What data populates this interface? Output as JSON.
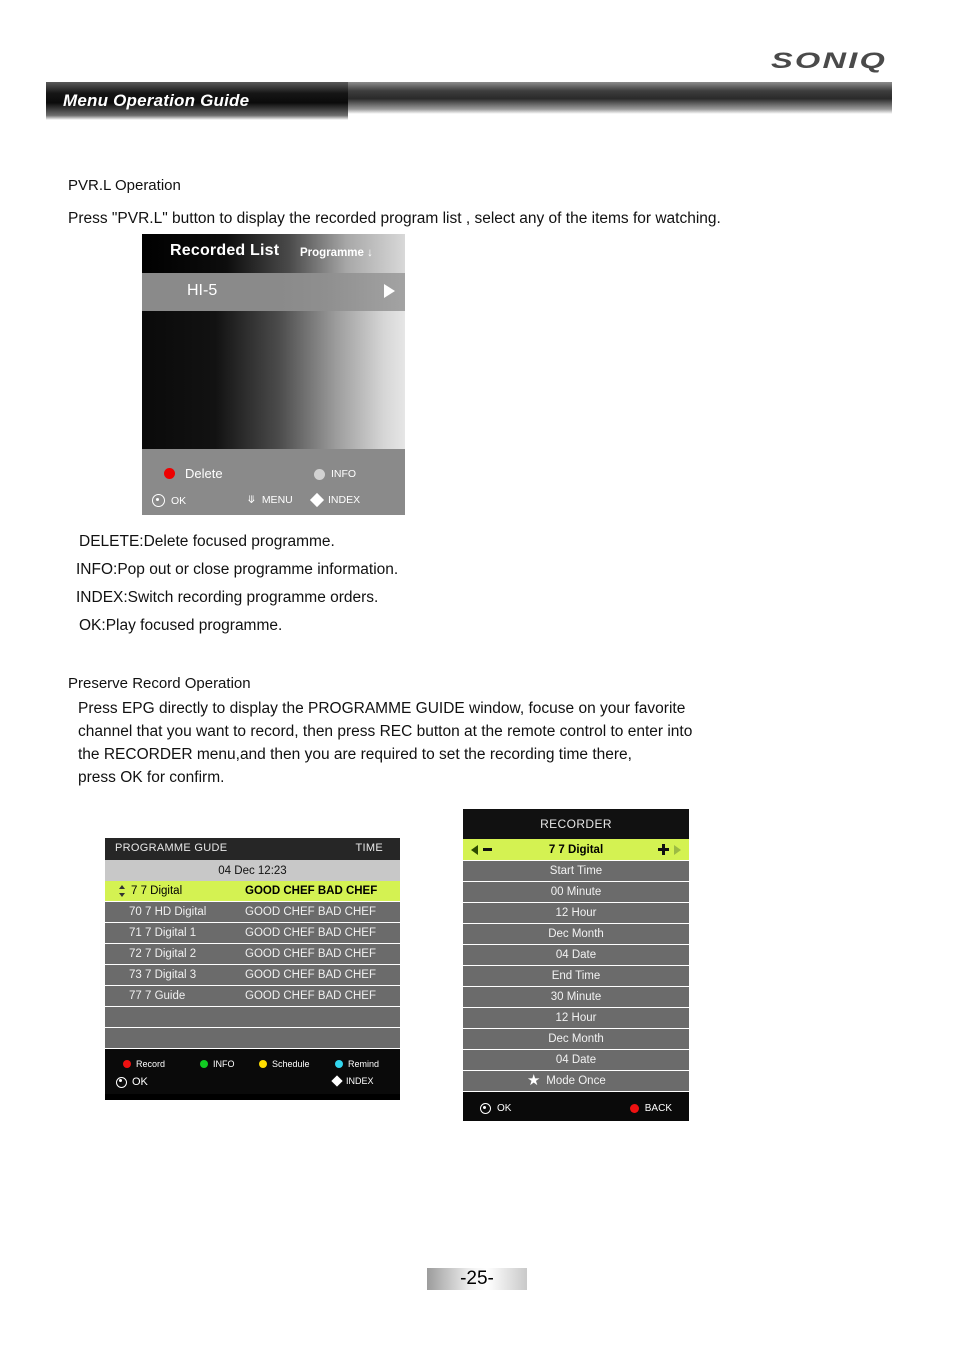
{
  "header": {
    "brand": "SONIQ",
    "tab_title": "Menu Operation Guide"
  },
  "sections": {
    "pvr": {
      "title": "PVR.L Operation",
      "intro": "Press \"PVR.L\" button to display the recorded program list , select any of the items for watching.",
      "notes": [
        "DELETE:Delete focused programme.",
        "INFO:Pop out or close programme information.",
        "INDEX:Switch recording programme orders.",
        "OK:Play focused programme."
      ]
    },
    "preserve": {
      "title": "Preserve Record Operation",
      "lines": [
        "Press EPG directly to display the PROGRAMME GUIDE window, focuse on your favorite",
        "channel that you want to record, then press REC button at the remote control to enter into",
        "the RECORDER menu,and then you are required to set the recording time there,",
        "press OK for confirm."
      ]
    }
  },
  "recorded_list": {
    "title": "Recorded List",
    "sort_label": "Programme ↓",
    "items": [
      {
        "label": "HI-5"
      }
    ],
    "footer": {
      "delete": "Delete",
      "info": "INFO",
      "ok": "OK",
      "menu": "MENU",
      "index": "INDEX"
    }
  },
  "epg": {
    "header_left": "PROGRAMME GUDE",
    "header_right": "TIME",
    "date": "04 Dec 12:23",
    "rows": [
      {
        "channel": "7 7 Digital",
        "programme": "GOOD CHEF BAD CHEF",
        "selected": true
      },
      {
        "channel": "70 7 HD Digital",
        "programme": "GOOD CHEF BAD CHEF",
        "selected": false
      },
      {
        "channel": "71 7 Digital 1",
        "programme": "GOOD CHEF BAD CHEF",
        "selected": false
      },
      {
        "channel": "72 7 Digital 2",
        "programme": "GOOD CHEF BAD CHEF",
        "selected": false
      },
      {
        "channel": "73 7 Digital 3",
        "programme": "GOOD CHEF BAD CHEF",
        "selected": false
      },
      {
        "channel": "77 7 Guide",
        "programme": "GOOD CHEF BAD CHEF",
        "selected": false
      },
      {
        "channel": "",
        "programme": "",
        "selected": false
      },
      {
        "channel": "",
        "programme": "",
        "selected": false
      }
    ],
    "footer": {
      "record": "Record",
      "info": "INFO",
      "schedule": "Schedule",
      "remind": "Remind",
      "ok": "OK",
      "index": "INDEX"
    }
  },
  "recorder": {
    "title": "RECORDER",
    "rows": [
      {
        "label": "7 7 Digital",
        "selected": true,
        "star": false
      },
      {
        "label": "Start Time",
        "selected": false,
        "star": false
      },
      {
        "label": "00 Minute",
        "selected": false,
        "star": false
      },
      {
        "label": "12 Hour",
        "selected": false,
        "star": false
      },
      {
        "label": "Dec Month",
        "selected": false,
        "star": false
      },
      {
        "label": "04 Date",
        "selected": false,
        "star": false
      },
      {
        "label": "End Time",
        "selected": false,
        "star": false
      },
      {
        "label": "30 Minute",
        "selected": false,
        "star": false
      },
      {
        "label": "12 Hour",
        "selected": false,
        "star": false
      },
      {
        "label": "Dec Month",
        "selected": false,
        "star": false
      },
      {
        "label": "04 Date",
        "selected": false,
        "star": false
      },
      {
        "label": "Mode Once",
        "selected": false,
        "star": true
      }
    ],
    "footer": {
      "ok": "OK",
      "back": "BACK"
    }
  },
  "page_footer": {
    "page_number": "-25-"
  },
  "colors": {
    "highlight": "#d4f252",
    "row_gray": "#6b6b6b",
    "record_red": "#ee1111",
    "info_green": "#11cc22",
    "schedule_yellow": "#ffdd00",
    "remind_cyan": "#33d6ee"
  }
}
